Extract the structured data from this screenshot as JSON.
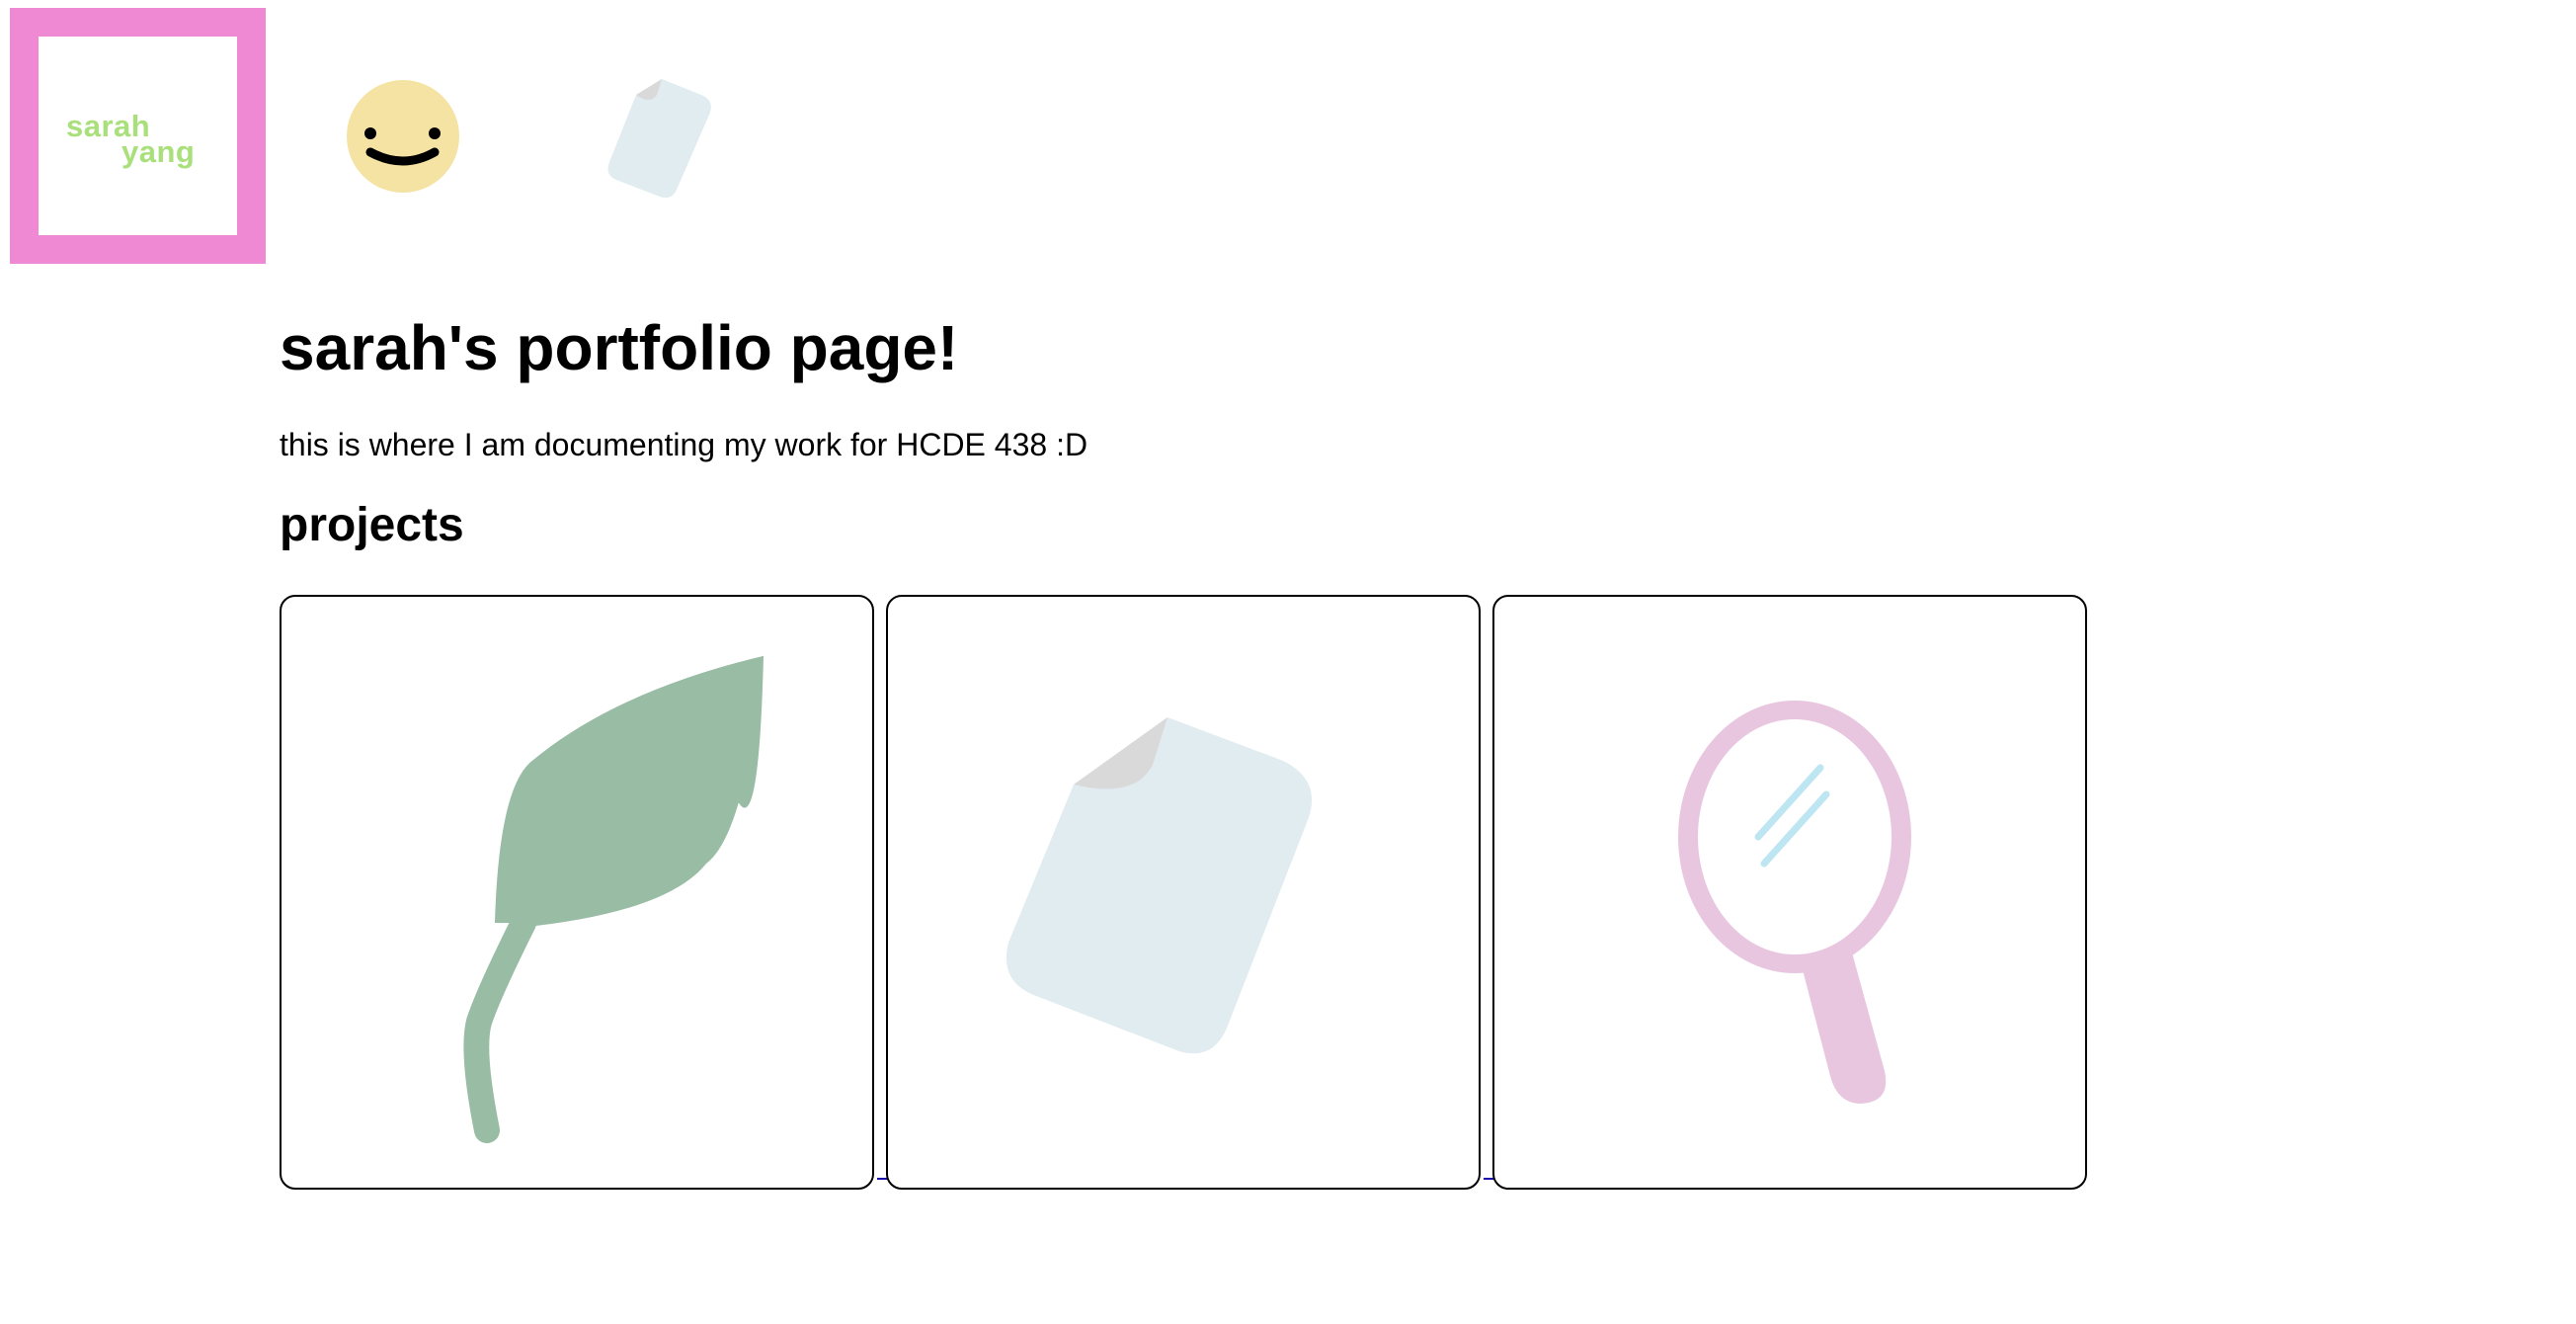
{
  "header": {
    "logo": {
      "line1": "sarah",
      "line2": "yang",
      "border_color": "#ef89d4",
      "text_color": "#a9e07b"
    },
    "nav": [
      {
        "icon": "smiley-icon",
        "color": "#f5e3a4"
      },
      {
        "icon": "paper-icon",
        "color": "#e1ecf0"
      }
    ]
  },
  "main": {
    "title": "sarah's portfolio page!",
    "intro": "this is where I am documenting my work for HCDE 438 :D",
    "projects_heading": "projects",
    "projects": [
      {
        "icon": "leaf-icon",
        "color": "#99bca4"
      },
      {
        "icon": "paper-icon",
        "color": "#e1ecf0"
      },
      {
        "icon": "mirror-icon",
        "color": "#e9c6e0"
      }
    ]
  }
}
